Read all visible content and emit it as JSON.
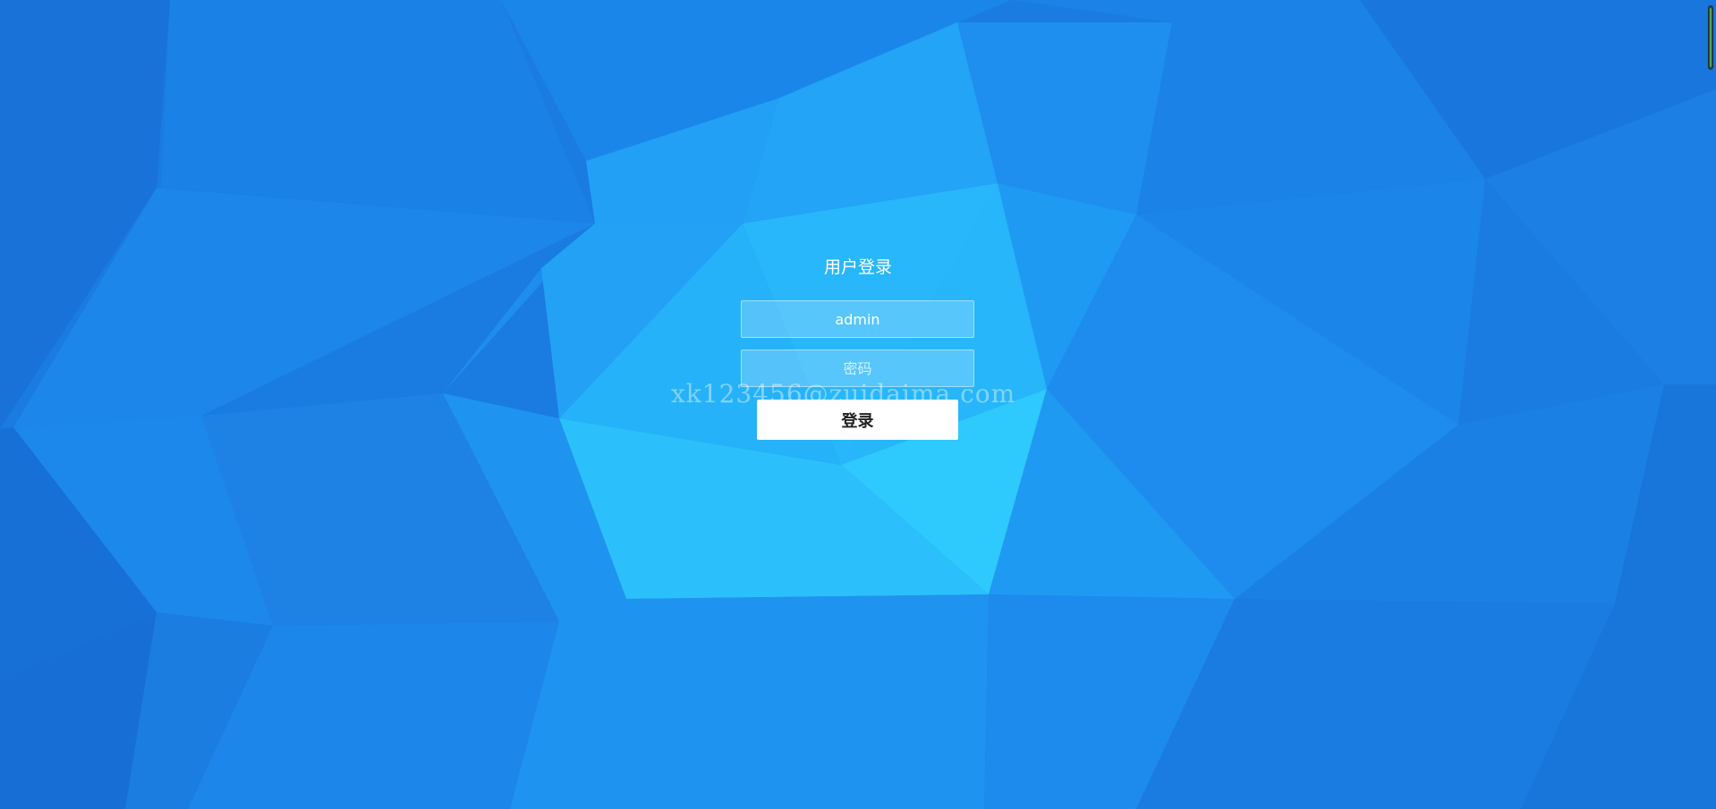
{
  "login": {
    "title": "用户登录",
    "username_value": "admin",
    "password_placeholder": "密码",
    "submit_label": "登录"
  },
  "watermark": {
    "text": "xk123456@zuidaima.com"
  },
  "colors": {
    "background_base": "#1a7be0",
    "panel_text": "#ffffff",
    "button_bg": "#ffffff",
    "button_text": "#222222"
  }
}
